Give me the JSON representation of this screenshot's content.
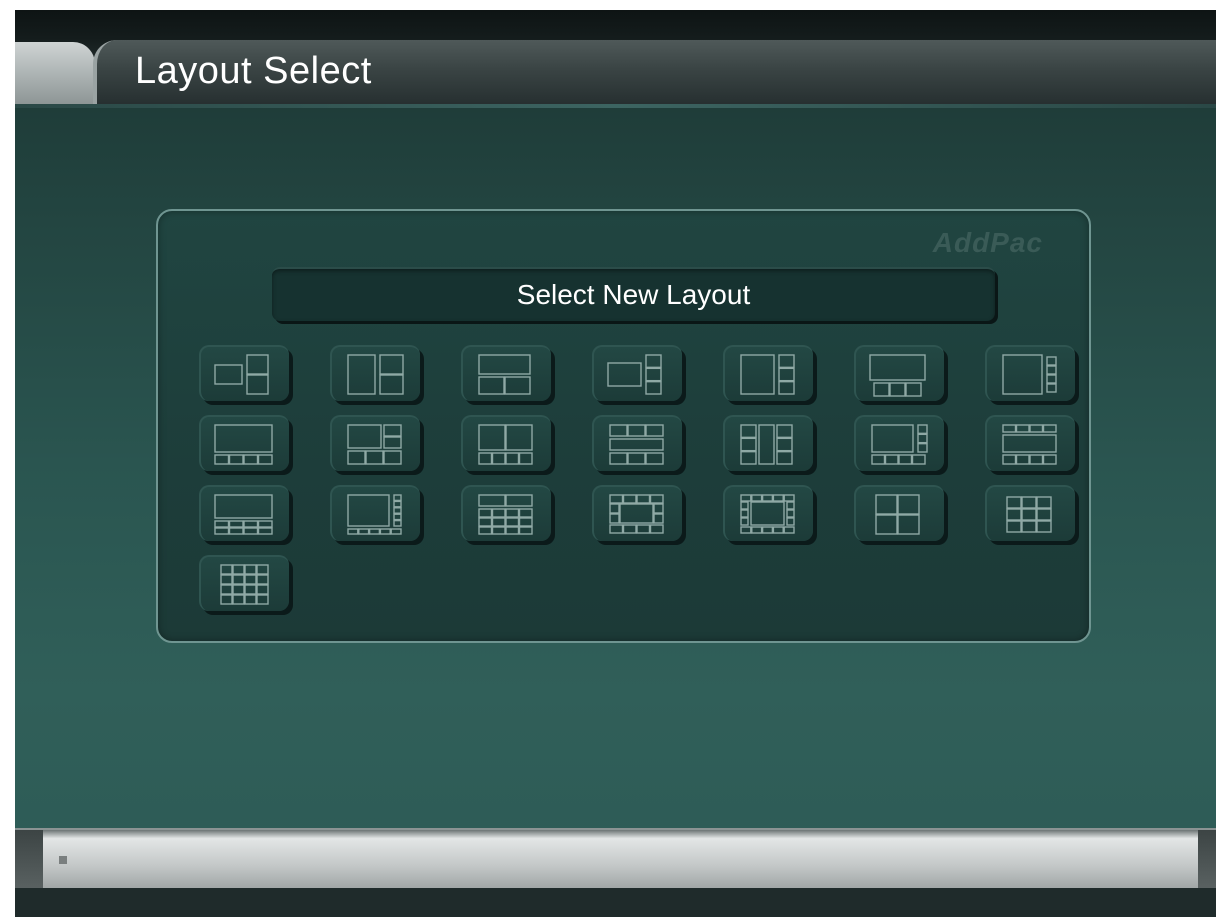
{
  "header": {
    "title": "Layout Select"
  },
  "panel": {
    "brand": "AddPac",
    "heading": "Select New Layout"
  },
  "layouts": [
    "1 large + 2 small (right)",
    "1 large left + 2 right",
    "1 top + 2 bottom",
    "1 large + 3 small (right)",
    "1 large left + 3 right",
    "1 top + 3 bottom",
    "1 large + 4 small (right)",
    "1 top + 4 bottom",
    "1 large + 2 right + 3 bottom",
    "2 top + 4 bottom",
    "3 top + 1 mid + 3 bottom",
    "2 left + 1 center + 3 right",
    "1 large + 3 right + 4 bottom",
    "4 top + 1 mid + 4 bottom",
    "1 top + 8 bottom",
    "1 large + 4 right + 5 bottom",
    "2 top + 8 bottom",
    "4 top + 1 mid with sides + 4 bottom",
    "5 top + 1 mid with sides + 5 bottom",
    "2x2 quad",
    "3x3 grid",
    "4x4 grid"
  ],
  "colors": {
    "icon_stroke": "#8fa9a5",
    "panel_border": "#6f9591",
    "background": "#2a5550"
  },
  "status": {
    "indicator": "square-indicator"
  }
}
